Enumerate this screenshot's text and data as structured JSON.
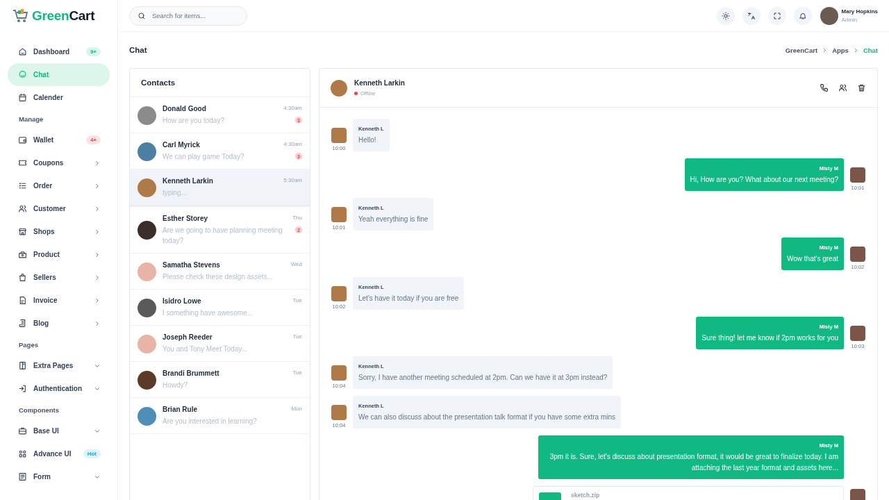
{
  "brand": {
    "name_first": "Green",
    "name_second": "Cart"
  },
  "sidebar": {
    "items": [
      {
        "kind": "link",
        "label": "Dashboard",
        "selected": false,
        "badge": {
          "text": "9+",
          "color": "#10b981"
        }
      },
      {
        "kind": "link",
        "label": "Chat",
        "selected": true
      },
      {
        "kind": "link",
        "label": "Calender",
        "selected": false
      },
      {
        "kind": "heading",
        "label": "Manage"
      },
      {
        "kind": "link",
        "label": "Wallet",
        "selected": false,
        "badge": {
          "text": "4+",
          "color": "#ef4444"
        }
      },
      {
        "kind": "link",
        "label": "Coupons",
        "selected": false,
        "submenu": true,
        "expanded": false
      },
      {
        "kind": "link",
        "label": "Order",
        "selected": false,
        "submenu": true,
        "expanded": false
      },
      {
        "kind": "link",
        "label": "Customer",
        "selected": false,
        "submenu": true,
        "expanded": false
      },
      {
        "kind": "link",
        "label": "Shops",
        "selected": false,
        "submenu": true,
        "expanded": false
      },
      {
        "kind": "link",
        "label": "Product",
        "selected": false,
        "submenu": true,
        "expanded": false
      },
      {
        "kind": "link",
        "label": "Sellers",
        "selected": false,
        "submenu": true,
        "expanded": false
      },
      {
        "kind": "link",
        "label": "Invoice",
        "selected": false,
        "submenu": true,
        "expanded": false
      },
      {
        "kind": "link",
        "label": "Blog",
        "selected": false,
        "submenu": true,
        "expanded": false
      },
      {
        "kind": "heading",
        "label": "Pages"
      },
      {
        "kind": "link",
        "label": "Extra Pages",
        "selected": false,
        "submenu": true,
        "expanded": true
      },
      {
        "kind": "link",
        "label": "Authentication",
        "selected": false,
        "submenu": true,
        "expanded": true
      },
      {
        "kind": "heading",
        "label": "Components"
      },
      {
        "kind": "link",
        "label": "Base UI",
        "selected": false,
        "submenu": true,
        "expanded": true
      },
      {
        "kind": "link",
        "label": "Advance UI",
        "selected": false,
        "badge": {
          "text": "Hot",
          "color": "#06b6d4"
        }
      },
      {
        "kind": "link",
        "label": "Form",
        "selected": false,
        "submenu": true,
        "expanded": true
      }
    ]
  },
  "header": {
    "search": {
      "placeholder": "Search for items..."
    },
    "user": {
      "name": "Mary Hopkins",
      "role": "Admin"
    }
  },
  "page": {
    "title": "Chat",
    "breadcrumbs": [
      {
        "label": "GreenCart",
        "selected": false
      },
      {
        "label": "Apps",
        "selected": false
      },
      {
        "label": "Chat",
        "selected": true
      }
    ]
  },
  "contacts": {
    "title": "Contacts",
    "items": [
      {
        "name": "Donald Good",
        "preview": "How are you today?",
        "time": "4:30am",
        "unread": "3",
        "selected": false
      },
      {
        "name": "Carl Myrick",
        "preview": "We can play game Today?",
        "time": "4:30am",
        "unread": "3",
        "selected": false
      },
      {
        "name": "Kenneth Larkin",
        "preview": "typing...",
        "time": "5:30am",
        "selected": true
      },
      {
        "name": "Esther Storey",
        "preview": "Are we going to have planning meeting today?",
        "time": "Thu",
        "unread": "2",
        "selected": false
      },
      {
        "name": "Samatha Stevens",
        "preview": "Please check these design assets...",
        "time": "Wed",
        "selected": false
      },
      {
        "name": "Isidro Lowe",
        "preview": "I something have awesome...",
        "time": "Tue",
        "selected": false
      },
      {
        "name": "Joseph Reeder",
        "preview": "You and Tony Meet Today...",
        "time": "Tue",
        "selected": false
      },
      {
        "name": "Brandi Brummett",
        "preview": "Howdy?",
        "time": "Tue",
        "selected": false
      },
      {
        "name": "Brian Rule",
        "preview": "Are you interested in learning?",
        "time": "Mon",
        "selected": false
      }
    ]
  },
  "chat": {
    "contact": {
      "name": "Kenneth Larkin",
      "status": {
        "text": "Offline",
        "color": "#ef4444"
      }
    },
    "messages": [
      {
        "kind": "in",
        "sender": "Kenneth L",
        "text": "Hello!",
        "time": "10:00"
      },
      {
        "kind": "out",
        "sender": "Misty M",
        "text": "Hi, How are you? What about our next meeting?",
        "time": "10:01"
      },
      {
        "kind": "in",
        "sender": "Kenneth L",
        "text": "Yeah everything is fine",
        "time": "10:01"
      },
      {
        "kind": "out",
        "sender": "Misty M",
        "text": "Wow that's great",
        "time": "10:02"
      },
      {
        "kind": "in",
        "sender": "Kenneth L",
        "text": "Let's have it today if you are free",
        "time": "10:02"
      },
      {
        "kind": "out",
        "sender": "Misty M",
        "text": "Sure thing! let me know if 2pm works for you",
        "time": "10:03"
      },
      {
        "kind": "in",
        "sender": "Kenneth L",
        "text": "Sorry, I have another meeting scheduled at 2pm. Can we have it at 3pm instead?",
        "time": "10:04"
      },
      {
        "kind": "in",
        "sender": "Kenneth L",
        "text": "We can also discuss about the presentation talk format if you have some extra mins",
        "time": "10:04"
      },
      {
        "kind": "out",
        "sender": "Misty M",
        "text": "3pm it is. Sure, let's discuss about presentation format, it would be great to finalize today. I am attaching the last year format and assets here..."
      },
      {
        "kind": "file",
        "file_name": "sketch.zip"
      }
    ]
  }
}
